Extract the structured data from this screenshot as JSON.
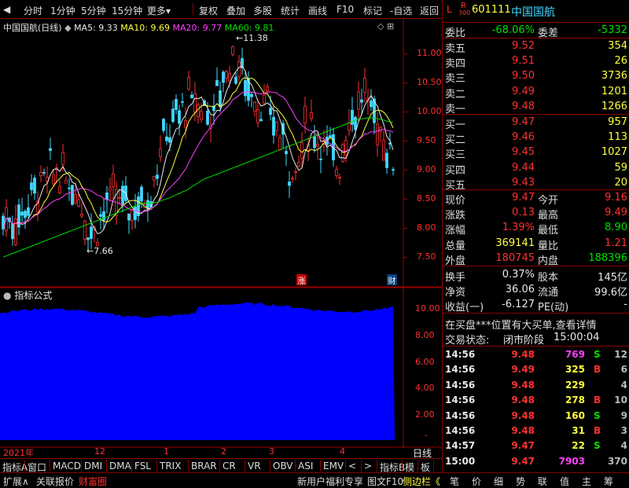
{
  "toolbar": {
    "items": [
      "分时",
      "1分钟",
      "5分钟",
      "15分钟",
      "更多",
      "复权",
      "叠加",
      "多股",
      "统计",
      "画线",
      "F10",
      "标记",
      "-自选",
      "返回"
    ]
  },
  "chart": {
    "legend": {
      "name": "中国国航(日线)",
      "ma5": "MA5: 9.33",
      "ma10": "MA10: 9.69",
      "ma20": "MA20: 9.77",
      "ma60": "MA60: 9.81"
    },
    "price_ticks": [
      "11.00",
      "10.50",
      "10.00",
      "9.50",
      "9.00",
      "8.50",
      "8.00",
      "7.50"
    ],
    "high_label": "11.38",
    "low_label": "7.66",
    "badge_up": "涨",
    "badge_fin": "财",
    "indicator_title": "指标公式",
    "indicator_ticks": [
      "10.00",
      "8.00",
      "6.00",
      "4.00",
      "2.00"
    ],
    "date_labels": [
      "2021年",
      "12",
      "1",
      "2",
      "3",
      "4"
    ],
    "period": "日线"
  },
  "chart_data": {
    "type": "candlestick",
    "title": "中国国航(日线)",
    "ylim": [
      7.3,
      11.6
    ],
    "series": [
      {
        "name": "MA5",
        "last": 9.33
      },
      {
        "name": "MA10",
        "last": 9.69
      },
      {
        "name": "MA20",
        "last": 9.77
      },
      {
        "name": "MA60",
        "last": 9.81
      }
    ],
    "high": 11.38,
    "low": 7.66
  },
  "tabs": [
    "指标A",
    "窗口",
    "MACD",
    "DMI",
    "DMA",
    "FSL",
    "TRIX",
    "BRAR",
    "CR",
    "VR",
    "OBV",
    "ASI",
    "EMV",
    "<",
    ">",
    "指标B",
    "模",
    "板"
  ],
  "bottom": {
    "left": [
      "扩展∧",
      "关联报价",
      "财富圈"
    ],
    "marquee": "新用户福利专享",
    "f10": "图文F10",
    "side": "侧边栏《",
    "tabs": [
      "笔",
      "价",
      "细",
      "势",
      "联",
      "值",
      "主",
      "筹"
    ]
  },
  "quote": {
    "flag_l": "L",
    "flag_r": "R",
    "flag_num": "300",
    "code": "601111",
    "name": "中国国航",
    "weibi_label": "委比",
    "weibi": "-68.06%",
    "weicha_label": "委差",
    "weicha": "-5332",
    "asks": [
      {
        "label": "卖五",
        "price": "9.52",
        "vol": "354"
      },
      {
        "label": "卖四",
        "price": "9.51",
        "vol": "26"
      },
      {
        "label": "卖三",
        "price": "9.50",
        "vol": "3736"
      },
      {
        "label": "卖二",
        "price": "9.49",
        "vol": "1201"
      },
      {
        "label": "卖一",
        "price": "9.48",
        "vol": "1266"
      }
    ],
    "bids": [
      {
        "label": "买一",
        "price": "9.47",
        "vol": "957"
      },
      {
        "label": "买二",
        "price": "9.46",
        "vol": "113"
      },
      {
        "label": "买三",
        "price": "9.45",
        "vol": "1027"
      },
      {
        "label": "买四",
        "price": "9.44",
        "vol": "59"
      },
      {
        "label": "买五",
        "price": "9.43",
        "vol": "20"
      }
    ],
    "stats": [
      {
        "l1": "现价",
        "v1": "9.47",
        "l2": "今开",
        "v2": "9.16"
      },
      {
        "l1": "涨跌",
        "v1": "0.13",
        "l2": "最高",
        "v2": "9.49"
      },
      {
        "l1": "涨幅",
        "v1": "1.39%",
        "l2": "最低",
        "v2": "8.90"
      },
      {
        "l1": "总量",
        "v1": "369141",
        "l2": "量比",
        "v2": "1.21"
      },
      {
        "l1": "外盘",
        "v1": "180745",
        "l2": "内盘",
        "v2": "188396"
      }
    ],
    "info": [
      {
        "l1": "换手",
        "v1": "0.37%",
        "l2": "股本",
        "v2": "145亿"
      },
      {
        "l1": "净资",
        "v1": "36.06",
        "l2": "流通",
        "v2": "99.6亿"
      },
      {
        "l1": "收益(一)",
        "v1": "-6.127",
        "l2": "PE(动)",
        "v2": "-"
      }
    ],
    "notice": "在买盘***位置有大买单,查看详情",
    "trade_status_label": "交易状态:",
    "trade_status": "闭市阶段",
    "trade_time": "15:00:04",
    "ticks": [
      {
        "t": "14:56",
        "p": "9.48",
        "v": "769",
        "s": "S",
        "n": "12"
      },
      {
        "t": "14:56",
        "p": "9.49",
        "v": "325",
        "s": "B",
        "n": "6"
      },
      {
        "t": "14:56",
        "p": "9.48",
        "v": "229",
        "s": "",
        "n": "4"
      },
      {
        "t": "14:56",
        "p": "9.48",
        "v": "278",
        "s": "B",
        "n": "10"
      },
      {
        "t": "14:56",
        "p": "9.48",
        "v": "160",
        "s": "S",
        "n": "9"
      },
      {
        "t": "14:56",
        "p": "9.48",
        "v": "31",
        "s": "B",
        "n": "3"
      },
      {
        "t": "14:57",
        "p": "9.47",
        "v": "22",
        "s": "S",
        "n": "4"
      },
      {
        "t": "15:00",
        "p": "9.47",
        "v": "7903",
        "s": "",
        "n": "370"
      }
    ]
  }
}
